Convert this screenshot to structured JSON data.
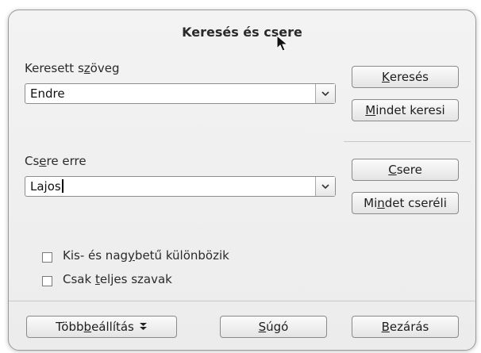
{
  "dialog": {
    "title": "Keresés és csere"
  },
  "search": {
    "label_pre": "Keresett s",
    "label_u": "z",
    "label_post": "öveg",
    "value": "Endre"
  },
  "replace": {
    "label_pre": "Cs",
    "label_u": "e",
    "label_post": "re erre",
    "value": "Lajos"
  },
  "buttons": {
    "find": {
      "pre": "",
      "u": "K",
      "post": "eresés"
    },
    "find_all": {
      "pre": "",
      "u": "M",
      "post": "indet keresi"
    },
    "replace": {
      "pre": "",
      "u": "C",
      "post": "sere"
    },
    "replace_all": {
      "pre": "Mi",
      "u": "n",
      "post": "det cseréli"
    },
    "more_options": {
      "pre": "Több ",
      "u": "b",
      "post": "eállítás",
      "icon": "double-chevron-down-icon"
    },
    "help": {
      "pre": "",
      "u": "S",
      "post": "úgó"
    },
    "close": {
      "pre": "",
      "u": "B",
      "post": "ezárás"
    }
  },
  "options": {
    "match_case": {
      "pre": "Kis- és nag",
      "u": "y",
      "post": "betű különbözik",
      "checked": false
    },
    "whole_words": {
      "pre": "Csak ",
      "u": "t",
      "post": "eljes szavak",
      "checked": false
    }
  }
}
